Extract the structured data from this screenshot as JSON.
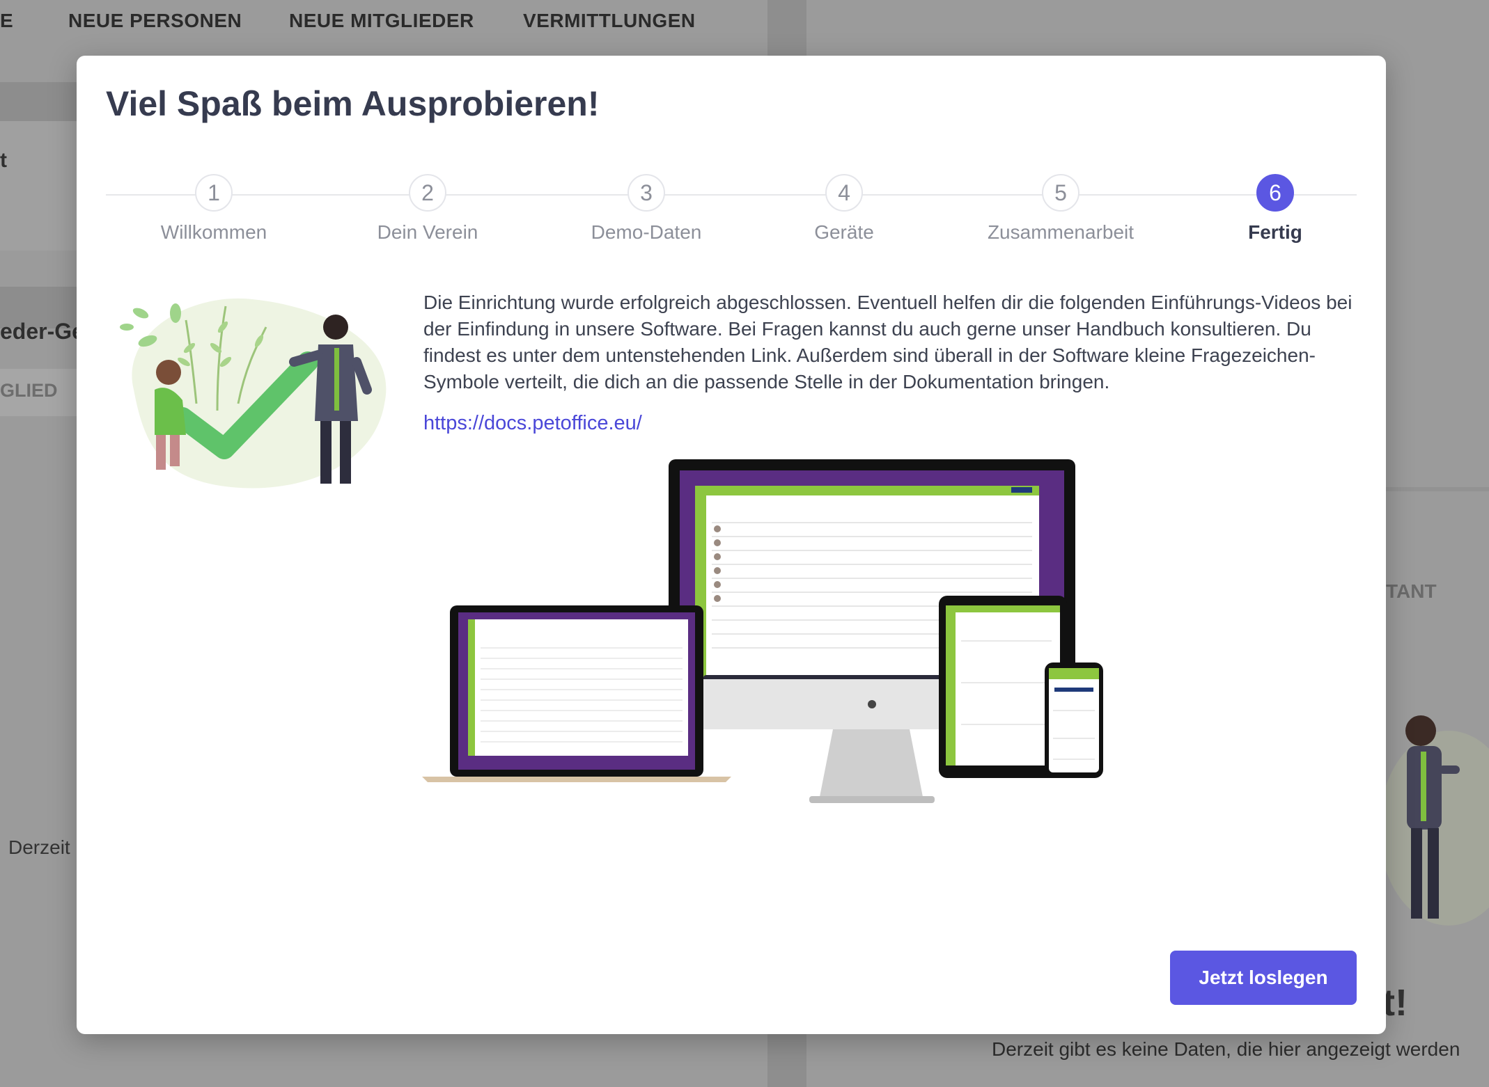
{
  "background": {
    "nav": [
      "E",
      "NEUE PERSONEN",
      "NEUE MITGLIEDER",
      "VERMITTLUNGEN"
    ],
    "left_fragment_t": "t",
    "left_fragment_header": "eder-Ge",
    "left_fragment_tab": "GLIED",
    "left_fragment_empty": "Derzeit",
    "right_fragment_tab": "TANT",
    "right_fragment_heading": "t!",
    "right_empty_text": "Derzeit gibt es keine Daten, die hier angezeigt werden"
  },
  "modal": {
    "title": "Viel Spaß beim Ausprobieren!",
    "steps": [
      {
        "number": "1",
        "label": "Willkommen"
      },
      {
        "number": "2",
        "label": "Dein Verein"
      },
      {
        "number": "3",
        "label": "Demo-Daten"
      },
      {
        "number": "4",
        "label": "Geräte"
      },
      {
        "number": "5",
        "label": "Zusammenarbeit"
      },
      {
        "number": "6",
        "label": "Fertig"
      }
    ],
    "active_step": 6,
    "description": "Die Einrichtung wurde erfolgreich abgeschlossen. Eventuell helfen dir die folgenden Einführungs-Videos bei der Einfindung in unsere Software. Bei Fragen kannst du auch gerne unser Handbuch konsultieren. Du findest es unter dem untenstehenden Link. Außerdem sind überall in der Software kleine Fragezeichen-Symbole verteilt, die dich an die passende Stelle in der Dokumentation bringen.",
    "docs_link": "https://docs.petoffice.eu/",
    "devices_image": "multi-device-mockup",
    "illustration": "success-checkmark-illustration",
    "submit_label": "Jetzt loslegen"
  },
  "colors": {
    "accent": "#5b57e2",
    "link": "#4a47d8",
    "app_green": "#8dc63f",
    "app_purple": "#5a2d82",
    "check_green": "#5fc36a"
  }
}
